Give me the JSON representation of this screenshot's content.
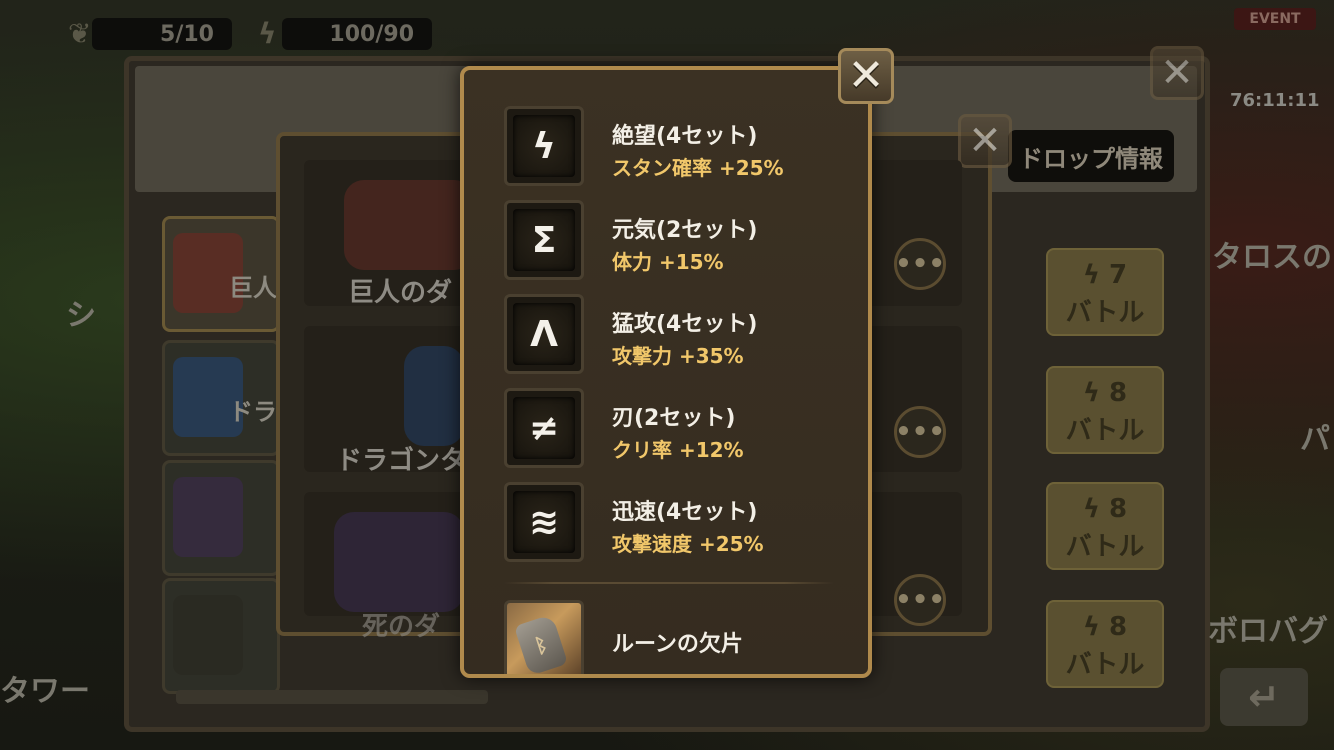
{
  "topbar": {
    "wings_value": "5/10",
    "energy_value": "100/90",
    "event_label": "EVENT",
    "event_timer": "76:11:11"
  },
  "dungeon_panel": {
    "drop_info_label": "ドロップ情報",
    "tabs": [
      {
        "label": "巨人"
      },
      {
        "label": "ドラ"
      },
      {
        "label": ""
      },
      {
        "label": ""
      }
    ],
    "rows": [
      {
        "name": "巨人のダ"
      },
      {
        "name": "ドラゴンタ"
      },
      {
        "name": "死のダ"
      }
    ],
    "more_label": "•••",
    "battles": [
      {
        "cost": "7",
        "label": "バトル"
      },
      {
        "cost": "8",
        "label": "バトル"
      },
      {
        "cost": "8",
        "label": "バトル"
      },
      {
        "cost": "8",
        "label": "バトル"
      }
    ],
    "side_texts": {
      "left_top": "シ",
      "left_bottom": "タワー",
      "right_top": "タロスの",
      "right_mid": "パ",
      "right_bottom": "ボロバグ"
    }
  },
  "rune_popup": {
    "close_label": "✕",
    "runes": [
      {
        "name": "絶望(4セット)",
        "effect": "スタン確率 +25%",
        "icon": "ϟ",
        "icon_name": "despair-rune-icon"
      },
      {
        "name": "元気(2セット)",
        "effect": "体力 +15%",
        "icon": "Σ",
        "icon_name": "energy-rune-icon"
      },
      {
        "name": "猛攻(4セット)",
        "effect": "攻撃力 +35%",
        "icon": "Λ",
        "icon_name": "fatal-rune-icon"
      },
      {
        "name": "刃(2セット)",
        "effect": "クリ率 +12%",
        "icon": "≠",
        "icon_name": "blade-rune-icon"
      },
      {
        "name": "迅速(4セット)",
        "effect": "攻撃速度 +25%",
        "icon": "≋",
        "icon_name": "swift-rune-icon"
      }
    ],
    "shard_label": "ルーンの欠片"
  },
  "colors": {
    "popup_border": "#b08a4c",
    "effect_text": "#f1c76a",
    "name_text": "#f3efe6"
  }
}
